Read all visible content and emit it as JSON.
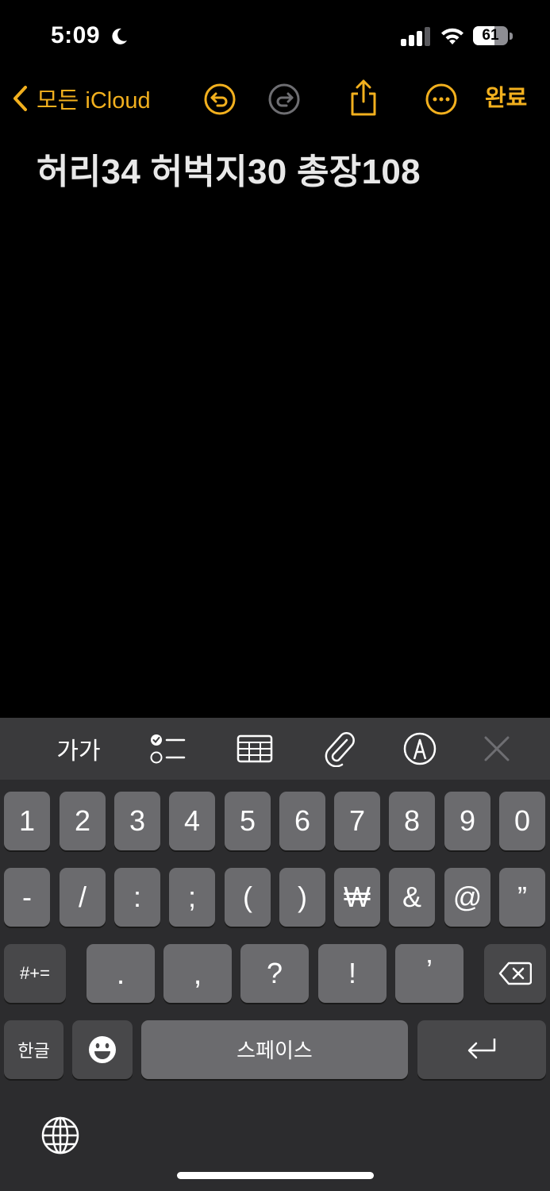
{
  "status": {
    "time": "5:09",
    "battery": "61",
    "battery_level": 0.61
  },
  "nav": {
    "back_label": "모든 iCloud",
    "done_label": "완료"
  },
  "note": {
    "text": "허리34 허벅지30 총장108"
  },
  "keyboard": {
    "toolbar": {
      "format_label": "가가"
    },
    "row1": [
      "1",
      "2",
      "3",
      "4",
      "5",
      "6",
      "7",
      "8",
      "9",
      "0"
    ],
    "row2": [
      "-",
      "/",
      ":",
      ";",
      "(",
      ")",
      "₩",
      "&",
      "@",
      "”"
    ],
    "row3": {
      "mode_label": "#+=",
      "keys": [
        ".",
        ",",
        "?",
        "!",
        "’"
      ]
    },
    "row4": {
      "lang_label": "한글",
      "space_label": "스페이스"
    }
  },
  "colors": {
    "accent": "#f2b01e",
    "key": "#6b6b6e",
    "key_dark": "#48484a",
    "keyboard_bg": "#2c2c2e"
  }
}
